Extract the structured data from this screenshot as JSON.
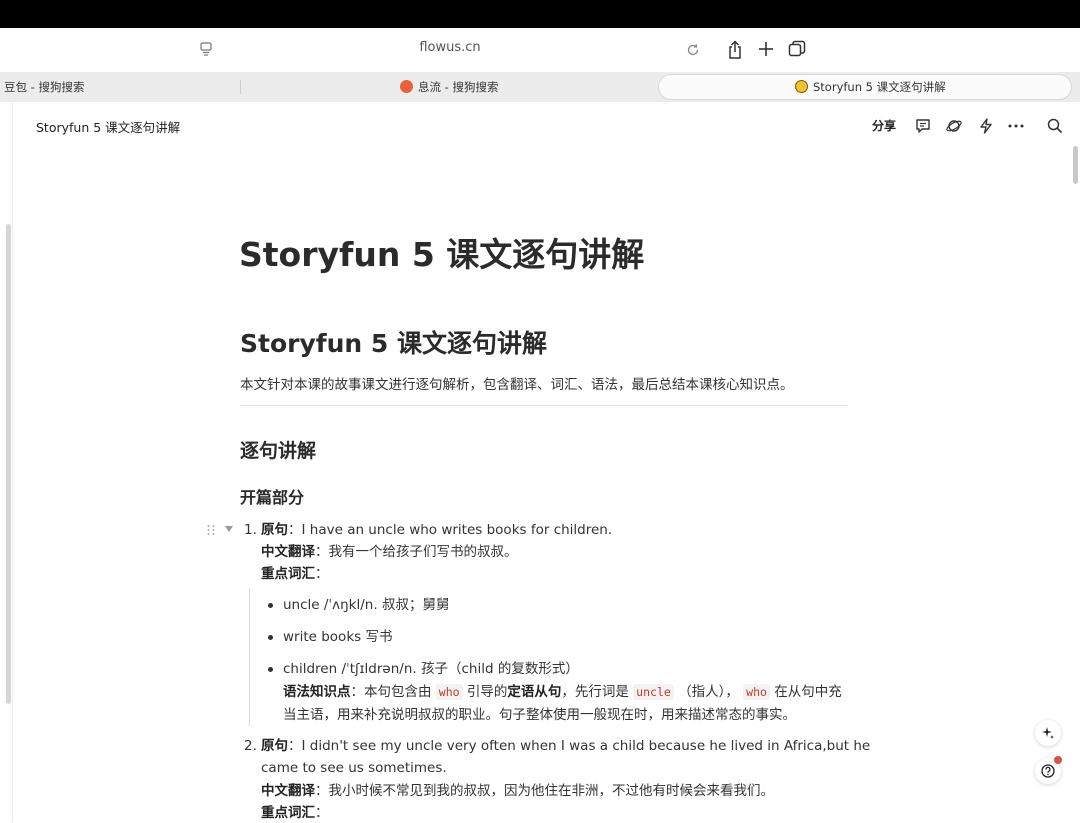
{
  "browser": {
    "url": "flowus.cn",
    "tabs": [
      {
        "label": "豆包 - 搜狗搜索"
      },
      {
        "label": "息流 - 搜狗搜索"
      },
      {
        "label": "Storyfun 5 课文逐句讲解"
      }
    ]
  },
  "header": {
    "doc_title": "Storyfun 5 课文逐句讲解",
    "share_label": "分享"
  },
  "doc": {
    "page_title": "Storyfun 5 课文逐句讲解",
    "h1": "Storyfun 5 课文逐句讲解",
    "intro": "本文针对本课的故事课文进行逐句解析，包含翻译、词汇、语法，最后总结本课核心知识点。",
    "section": "逐句讲解",
    "subsection": "开篇部分",
    "items": [
      {
        "num": "1.",
        "orig_label": "原句",
        "orig_text": "：I have an uncle who writes books for children.",
        "trans_label": "中文翻译",
        "trans_text": "：我有一个给孩子们写书的叔叔。",
        "vocab_label": "重点词汇",
        "vocab_colon": "：",
        "vocab": [
          "uncle /ˈʌŋkl/n. 叔叔；舅舅",
          "write books 写书",
          "children /ˈtʃɪldrən/n. 孩子（child 的复数形式）"
        ],
        "grammar_label": "语法知识点",
        "grammar_p1": "：本句包含由 ",
        "grammar_code1": "who",
        "grammar_p2": " 引导的",
        "grammar_bold": "定语从句",
        "grammar_p3": "，先行词是 ",
        "grammar_code2": "uncle",
        "grammar_p4": " （指人）， ",
        "grammar_code3": "who",
        "grammar_p5": " 在从句中充",
        "grammar_line2": "当主语，用来补充说明叔叔的职业。句子整体使用一般现在时，用来描述常态的事实。"
      },
      {
        "num": "2.",
        "orig_label": "原句",
        "orig_text": "：I didn't see my uncle very often when I was a child because he lived in Africa,but he",
        "orig_text2": "came to see us sometimes.",
        "trans_label": "中文翻译",
        "trans_text": "：我小时候不常见到我的叔叔，因为他住在非洲，不过他有时候会来看我们。",
        "vocab_label": "重点词汇",
        "vocab_colon": "："
      }
    ]
  }
}
